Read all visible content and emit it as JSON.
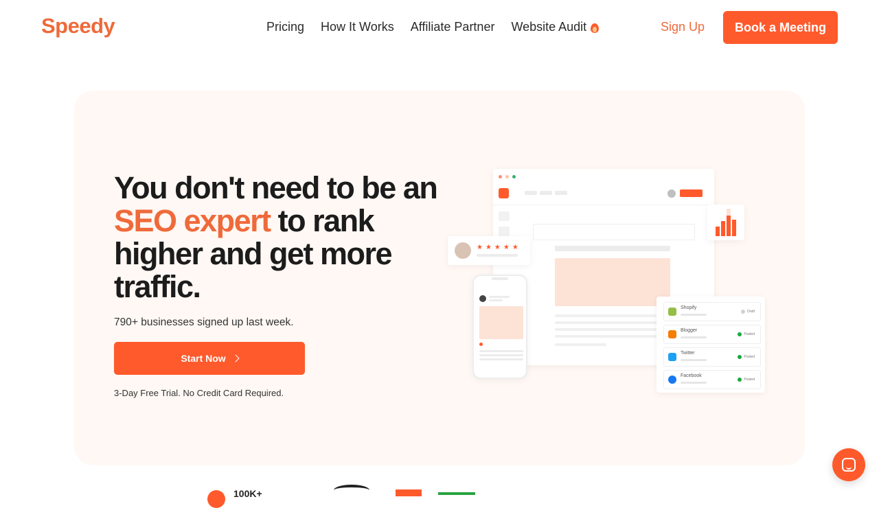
{
  "brand": {
    "name": "Speedy",
    "accent": "#ff5a2c",
    "accent_text": "#ef6a3a"
  },
  "nav": {
    "links": [
      "Pricing",
      "How It Works",
      "Affiliate Partner",
      "Website Audit"
    ],
    "fire_icon": "fire-icon",
    "signup_label": "Sign Up",
    "book_label": "Book a Meeting"
  },
  "hero": {
    "headline_part1": "You don't need to be an ",
    "headline_accent": "SEO expert",
    "headline_part2": " to rank higher and get more traffic.",
    "signed_up": "790+ businesses signed up last week.",
    "cta_label": "Start Now",
    "trial_note": "3-Day Free Trial. No Credit Card Required."
  },
  "illustration": {
    "stars": "★★★★★",
    "platforms": [
      {
        "name": "Shopify",
        "status": "Draft",
        "icon": "shopify-icon",
        "color": "#95bf47",
        "posted": false
      },
      {
        "name": "Blogger",
        "status": "Posted",
        "icon": "blogger-icon",
        "color": "#f57d00",
        "posted": true
      },
      {
        "name": "Twitter",
        "status": "Posted",
        "icon": "twitter-icon",
        "color": "#1da1f2",
        "posted": true
      },
      {
        "name": "Facebook",
        "status": "Posted",
        "icon": "facebook-icon",
        "color": "#1877f2",
        "posted": true
      }
    ]
  },
  "bottom": {
    "stat_partial": "100K+"
  }
}
